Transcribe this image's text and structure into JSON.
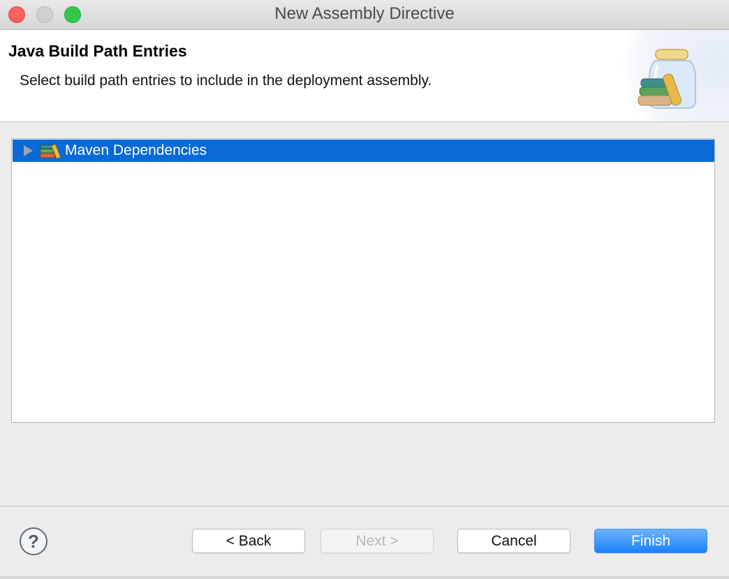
{
  "window": {
    "title": "New Assembly Directive"
  },
  "banner": {
    "title": "Java Build Path Entries",
    "description": "Select build path entries to include in the deployment assembly.",
    "icon": "jar-icon"
  },
  "tree": {
    "items": [
      {
        "label": "Maven Dependencies",
        "icon": "library-books-icon",
        "expanded": false,
        "selected": true
      }
    ]
  },
  "buttons": {
    "help": "?",
    "back": "< Back",
    "next": "Next >",
    "cancel": "Cancel",
    "finish": "Finish"
  },
  "colors": {
    "selection": "#0869d7",
    "finish_button": "#1a82fb",
    "close": "#fc605c",
    "maximize": "#34c84a"
  }
}
